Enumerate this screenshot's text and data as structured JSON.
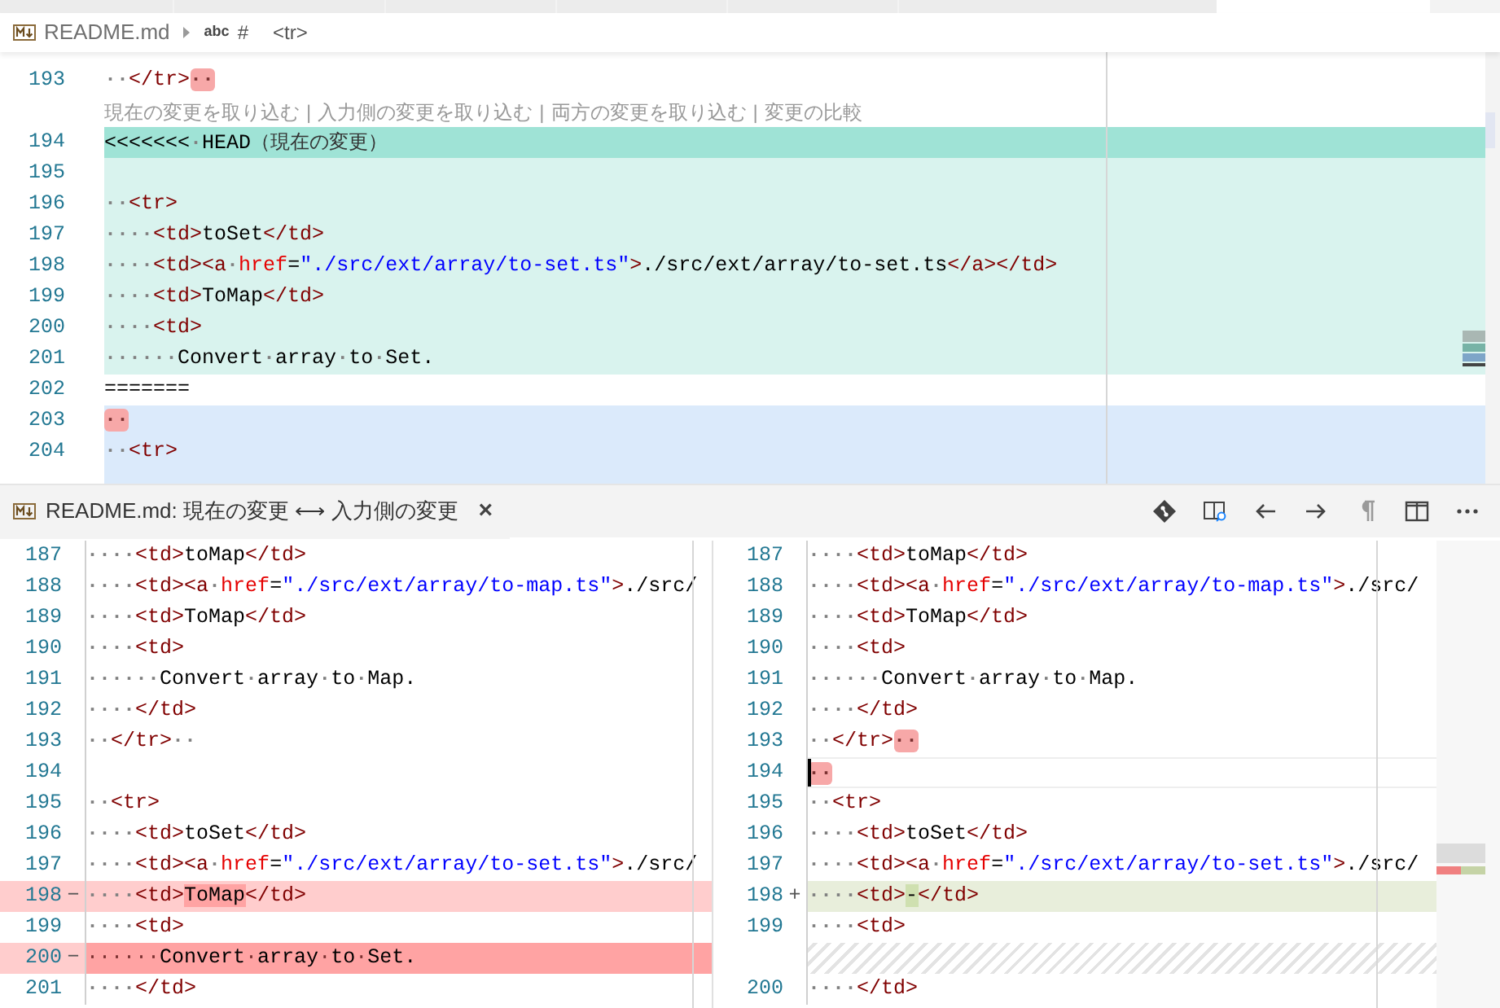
{
  "breadcrumbs": [
    {
      "kind": "file",
      "label": "README.md"
    },
    {
      "kind": "symbol",
      "symbol_label": "abc",
      "label": "#"
    },
    {
      "kind": "plain",
      "label": "<tr>"
    }
  ],
  "editor": {
    "lines": [
      {
        "kind": "plain",
        "number": "193",
        "tokens": [
          {
            "kind": "ws",
            "t": "··"
          },
          {
            "kind": "tag",
            "t": "</tr>"
          },
          {
            "kind": "trail",
            "t": "··"
          }
        ]
      },
      {
        "kind": "codelens",
        "actions": [
          "現在の変更を取り込む",
          "入力側の変更を取り込む",
          "両方の変更を取り込む",
          "変更の比較"
        ],
        "separator": "|"
      },
      {
        "kind": "current-header",
        "number": "194",
        "tokens": [
          {
            "kind": "text",
            "t": "<<<<<<<"
          },
          {
            "kind": "ws",
            "t": "·"
          },
          {
            "kind": "text",
            "t": "HEAD"
          },
          {
            "kind": "note",
            "t": "（現在の変更）"
          }
        ]
      },
      {
        "kind": "current",
        "number": "195"
      },
      {
        "kind": "current",
        "number": "196",
        "tokens": [
          {
            "kind": "ws",
            "t": "··"
          },
          {
            "kind": "tag",
            "t": "<tr>"
          }
        ]
      },
      {
        "kind": "current",
        "number": "197",
        "tokens": [
          {
            "kind": "ws",
            "t": "····"
          },
          {
            "kind": "tag",
            "t": "<td>"
          },
          {
            "kind": "text",
            "t": "toSet"
          },
          {
            "kind": "tag",
            "t": "</td>"
          }
        ]
      },
      {
        "kind": "current",
        "number": "198",
        "tokens": [
          {
            "kind": "ws",
            "t": "····"
          },
          {
            "kind": "tag",
            "t": "<td><a"
          },
          {
            "kind": "ws",
            "t": "·"
          },
          {
            "kind": "attr",
            "t": "href"
          },
          {
            "kind": "punct",
            "t": "="
          },
          {
            "kind": "str",
            "t": "\"./src/ext/array/to-set.ts\""
          },
          {
            "kind": "tag",
            "t": ">"
          },
          {
            "kind": "text",
            "t": "./src/ext/array/to-set.ts"
          },
          {
            "kind": "tag",
            "t": "</a></td>"
          }
        ]
      },
      {
        "kind": "current",
        "number": "199",
        "tokens": [
          {
            "kind": "ws",
            "t": "····"
          },
          {
            "kind": "tag",
            "t": "<td>"
          },
          {
            "kind": "text",
            "t": "ToMap"
          },
          {
            "kind": "tag",
            "t": "</td>"
          }
        ]
      },
      {
        "kind": "current",
        "number": "200",
        "tokens": [
          {
            "kind": "ws",
            "t": "····"
          },
          {
            "kind": "tag",
            "t": "<td>"
          }
        ]
      },
      {
        "kind": "current",
        "number": "201",
        "tokens": [
          {
            "kind": "ws",
            "t": "······"
          },
          {
            "kind": "text",
            "t": "Convert"
          },
          {
            "kind": "ws",
            "t": "·"
          },
          {
            "kind": "text",
            "t": "array"
          },
          {
            "kind": "ws",
            "t": "·"
          },
          {
            "kind": "text",
            "t": "to"
          },
          {
            "kind": "ws",
            "t": "·"
          },
          {
            "kind": "text",
            "t": "Set."
          }
        ]
      },
      {
        "kind": "plain",
        "number": "202",
        "tokens": [
          {
            "kind": "text",
            "t": "======="
          }
        ]
      },
      {
        "kind": "incoming",
        "number": "203",
        "tokens": [
          {
            "kind": "trail",
            "t": "··"
          }
        ]
      },
      {
        "kind": "incoming",
        "number": "204",
        "tokens": [
          {
            "kind": "ws",
            "t": "··"
          },
          {
            "kind": "tag",
            "t": "<tr>"
          }
        ]
      },
      {
        "kind": "incoming"
      }
    ]
  },
  "diff_editor": {
    "tab": {
      "label": "README.md: 現在の変更 ⟷ 入力側の変更",
      "close": "×",
      "selected": true
    },
    "toolbar": [
      {
        "kind": "git-compare"
      },
      {
        "kind": "inline-view"
      },
      {
        "kind": "previous"
      },
      {
        "kind": "next"
      },
      {
        "kind": "whitespace"
      },
      {
        "kind": "split"
      },
      {
        "kind": "more"
      }
    ],
    "left": {
      "lines": [
        {
          "kind": "plain",
          "number": "187",
          "tokens": [
            {
              "kind": "ws",
              "t": "····"
            },
            {
              "kind": "tag",
              "t": "<td>"
            },
            {
              "kind": "text",
              "t": "toMap"
            },
            {
              "kind": "tag",
              "t": "</td>"
            }
          ]
        },
        {
          "kind": "plain",
          "number": "188",
          "tokens": [
            {
              "kind": "ws",
              "t": "····"
            },
            {
              "kind": "tag",
              "t": "<td><a"
            },
            {
              "kind": "ws",
              "t": "·"
            },
            {
              "kind": "attr",
              "t": "href"
            },
            {
              "kind": "punct",
              "t": "="
            },
            {
              "kind": "str",
              "t": "\"./src/ext/array/to-map.ts\""
            },
            {
              "kind": "tag",
              "t": ">"
            },
            {
              "kind": "text",
              "t": "./src/"
            }
          ]
        },
        {
          "kind": "plain",
          "number": "189",
          "tokens": [
            {
              "kind": "ws",
              "t": "····"
            },
            {
              "kind": "tag",
              "t": "<td>"
            },
            {
              "kind": "text",
              "t": "ToMap"
            },
            {
              "kind": "tag",
              "t": "</td>"
            }
          ]
        },
        {
          "kind": "plain",
          "number": "190",
          "tokens": [
            {
              "kind": "ws",
              "t": "····"
            },
            {
              "kind": "tag",
              "t": "<td>"
            }
          ]
        },
        {
          "kind": "plain",
          "number": "191",
          "tokens": [
            {
              "kind": "ws",
              "t": "······"
            },
            {
              "kind": "text",
              "t": "Convert"
            },
            {
              "kind": "ws",
              "t": "·"
            },
            {
              "kind": "text",
              "t": "array"
            },
            {
              "kind": "ws",
              "t": "·"
            },
            {
              "kind": "text",
              "t": "to"
            },
            {
              "kind": "ws",
              "t": "·"
            },
            {
              "kind": "text",
              "t": "Map."
            }
          ]
        },
        {
          "kind": "plain",
          "number": "192",
          "tokens": [
            {
              "kind": "ws",
              "t": "····"
            },
            {
              "kind": "tag",
              "t": "</td>"
            }
          ]
        },
        {
          "kind": "plain",
          "number": "193",
          "tokens": [
            {
              "kind": "ws",
              "t": "··"
            },
            {
              "kind": "tag",
              "t": "</tr>"
            },
            {
              "kind": "ws",
              "t": "··"
            }
          ]
        },
        {
          "kind": "plain",
          "number": "194"
        },
        {
          "kind": "plain",
          "number": "195",
          "tokens": [
            {
              "kind": "ws",
              "t": "··"
            },
            {
              "kind": "tag",
              "t": "<tr>"
            }
          ]
        },
        {
          "kind": "plain",
          "number": "196",
          "tokens": [
            {
              "kind": "ws",
              "t": "····"
            },
            {
              "kind": "tag",
              "t": "<td>"
            },
            {
              "kind": "text",
              "t": "toSet"
            },
            {
              "kind": "tag",
              "t": "</td>"
            }
          ]
        },
        {
          "kind": "plain",
          "number": "197",
          "tokens": [
            {
              "kind": "ws",
              "t": "····"
            },
            {
              "kind": "tag",
              "t": "<td><a"
            },
            {
              "kind": "ws",
              "t": "·"
            },
            {
              "kind": "attr",
              "t": "href"
            },
            {
              "kind": "punct",
              "t": "="
            },
            {
              "kind": "str",
              "t": "\"./src/ext/array/to-set.ts\""
            },
            {
              "kind": "tag",
              "t": ">"
            },
            {
              "kind": "text",
              "t": "./src/"
            }
          ]
        },
        {
          "kind": "deleted",
          "number": "198",
          "marker": "−",
          "tokens": [
            {
              "kind": "ws",
              "t": "····"
            },
            {
              "kind": "tag",
              "t": "<td>"
            },
            {
              "kind": "text",
              "t": "ToMap",
              "changed": true
            },
            {
              "kind": "tag",
              "t": "</td>"
            }
          ]
        },
        {
          "kind": "plain",
          "number": "199",
          "tokens": [
            {
              "kind": "ws",
              "t": "····"
            },
            {
              "kind": "tag",
              "t": "<td>"
            }
          ]
        },
        {
          "kind": "deleted-whole",
          "number": "200",
          "marker": "−",
          "tokens": [
            {
              "kind": "ws",
              "t": "······"
            },
            {
              "kind": "text",
              "t": "Convert"
            },
            {
              "kind": "ws",
              "t": "·"
            },
            {
              "kind": "text",
              "t": "array"
            },
            {
              "kind": "ws",
              "t": "·"
            },
            {
              "kind": "text",
              "t": "to"
            },
            {
              "kind": "ws",
              "t": "·"
            },
            {
              "kind": "text",
              "t": "Set."
            }
          ]
        },
        {
          "kind": "plain",
          "number": "201",
          "tokens": [
            {
              "kind": "ws",
              "t": "····"
            },
            {
              "kind": "tag",
              "t": "</td>"
            }
          ]
        }
      ]
    },
    "right": {
      "lines": [
        {
          "kind": "plain",
          "number": "187",
          "tokens": [
            {
              "kind": "ws",
              "t": "····"
            },
            {
              "kind": "tag",
              "t": "<td>"
            },
            {
              "kind": "text",
              "t": "toMap"
            },
            {
              "kind": "tag",
              "t": "</td>"
            }
          ]
        },
        {
          "kind": "plain",
          "number": "188",
          "tokens": [
            {
              "kind": "ws",
              "t": "····"
            },
            {
              "kind": "tag",
              "t": "<td><a"
            },
            {
              "kind": "ws",
              "t": "·"
            },
            {
              "kind": "attr",
              "t": "href"
            },
            {
              "kind": "punct",
              "t": "="
            },
            {
              "kind": "str",
              "t": "\"./src/ext/array/to-map.ts\""
            },
            {
              "kind": "tag",
              "t": ">"
            },
            {
              "kind": "text",
              "t": "./src/"
            }
          ]
        },
        {
          "kind": "plain",
          "number": "189",
          "tokens": [
            {
              "kind": "ws",
              "t": "····"
            },
            {
              "kind": "tag",
              "t": "<td>"
            },
            {
              "kind": "text",
              "t": "ToMap"
            },
            {
              "kind": "tag",
              "t": "</td>"
            }
          ]
        },
        {
          "kind": "plain",
          "number": "190",
          "tokens": [
            {
              "kind": "ws",
              "t": "····"
            },
            {
              "kind": "tag",
              "t": "<td>"
            }
          ]
        },
        {
          "kind": "plain",
          "number": "191",
          "tokens": [
            {
              "kind": "ws",
              "t": "······"
            },
            {
              "kind": "text",
              "t": "Convert"
            },
            {
              "kind": "ws",
              "t": "·"
            },
            {
              "kind": "text",
              "t": "array"
            },
            {
              "kind": "ws",
              "t": "·"
            },
            {
              "kind": "text",
              "t": "to"
            },
            {
              "kind": "ws",
              "t": "·"
            },
            {
              "kind": "text",
              "t": "Map."
            }
          ]
        },
        {
          "kind": "plain",
          "number": "192",
          "tokens": [
            {
              "kind": "ws",
              "t": "····"
            },
            {
              "kind": "tag",
              "t": "</td>"
            }
          ]
        },
        {
          "kind": "plain",
          "number": "193",
          "tokens": [
            {
              "kind": "ws",
              "t": "··"
            },
            {
              "kind": "tag",
              "t": "</tr>"
            },
            {
              "kind": "trail",
              "t": "··"
            }
          ]
        },
        {
          "kind": "plain",
          "number": "194",
          "cursor": true,
          "tokens": [
            {
              "kind": "trail",
              "t": "··"
            }
          ]
        },
        {
          "kind": "plain",
          "number": "195",
          "tokens": [
            {
              "kind": "ws",
              "t": "··"
            },
            {
              "kind": "tag",
              "t": "<tr>"
            }
          ]
        },
        {
          "kind": "plain",
          "number": "196",
          "tokens": [
            {
              "kind": "ws",
              "t": "····"
            },
            {
              "kind": "tag",
              "t": "<td>"
            },
            {
              "kind": "text",
              "t": "toSet"
            },
            {
              "kind": "tag",
              "t": "</td>"
            }
          ]
        },
        {
          "kind": "plain",
          "number": "197",
          "tokens": [
            {
              "kind": "ws",
              "t": "····"
            },
            {
              "kind": "tag",
              "t": "<td><a"
            },
            {
              "kind": "ws",
              "t": "·"
            },
            {
              "kind": "attr",
              "t": "href"
            },
            {
              "kind": "punct",
              "t": "="
            },
            {
              "kind": "str",
              "t": "\"./src/ext/array/to-set.ts\""
            },
            {
              "kind": "tag",
              "t": ">"
            },
            {
              "kind": "text",
              "t": "./src/"
            }
          ]
        },
        {
          "kind": "inserted",
          "number": "198",
          "marker": "+",
          "tokens": [
            {
              "kind": "ws",
              "t": "····"
            },
            {
              "kind": "tag",
              "t": "<td>"
            },
            {
              "kind": "text",
              "t": "-",
              "changed": true
            },
            {
              "kind": "tag",
              "t": "</td>"
            }
          ]
        },
        {
          "kind": "plain",
          "number": "199",
          "tokens": [
            {
              "kind": "ws",
              "t": "····"
            },
            {
              "kind": "tag",
              "t": "<td>"
            }
          ]
        },
        {
          "kind": "filler"
        },
        {
          "kind": "plain",
          "number": "200",
          "tokens": [
            {
              "kind": "ws",
              "t": "····"
            },
            {
              "kind": "tag",
              "t": "</td>"
            }
          ]
        }
      ]
    }
  }
}
